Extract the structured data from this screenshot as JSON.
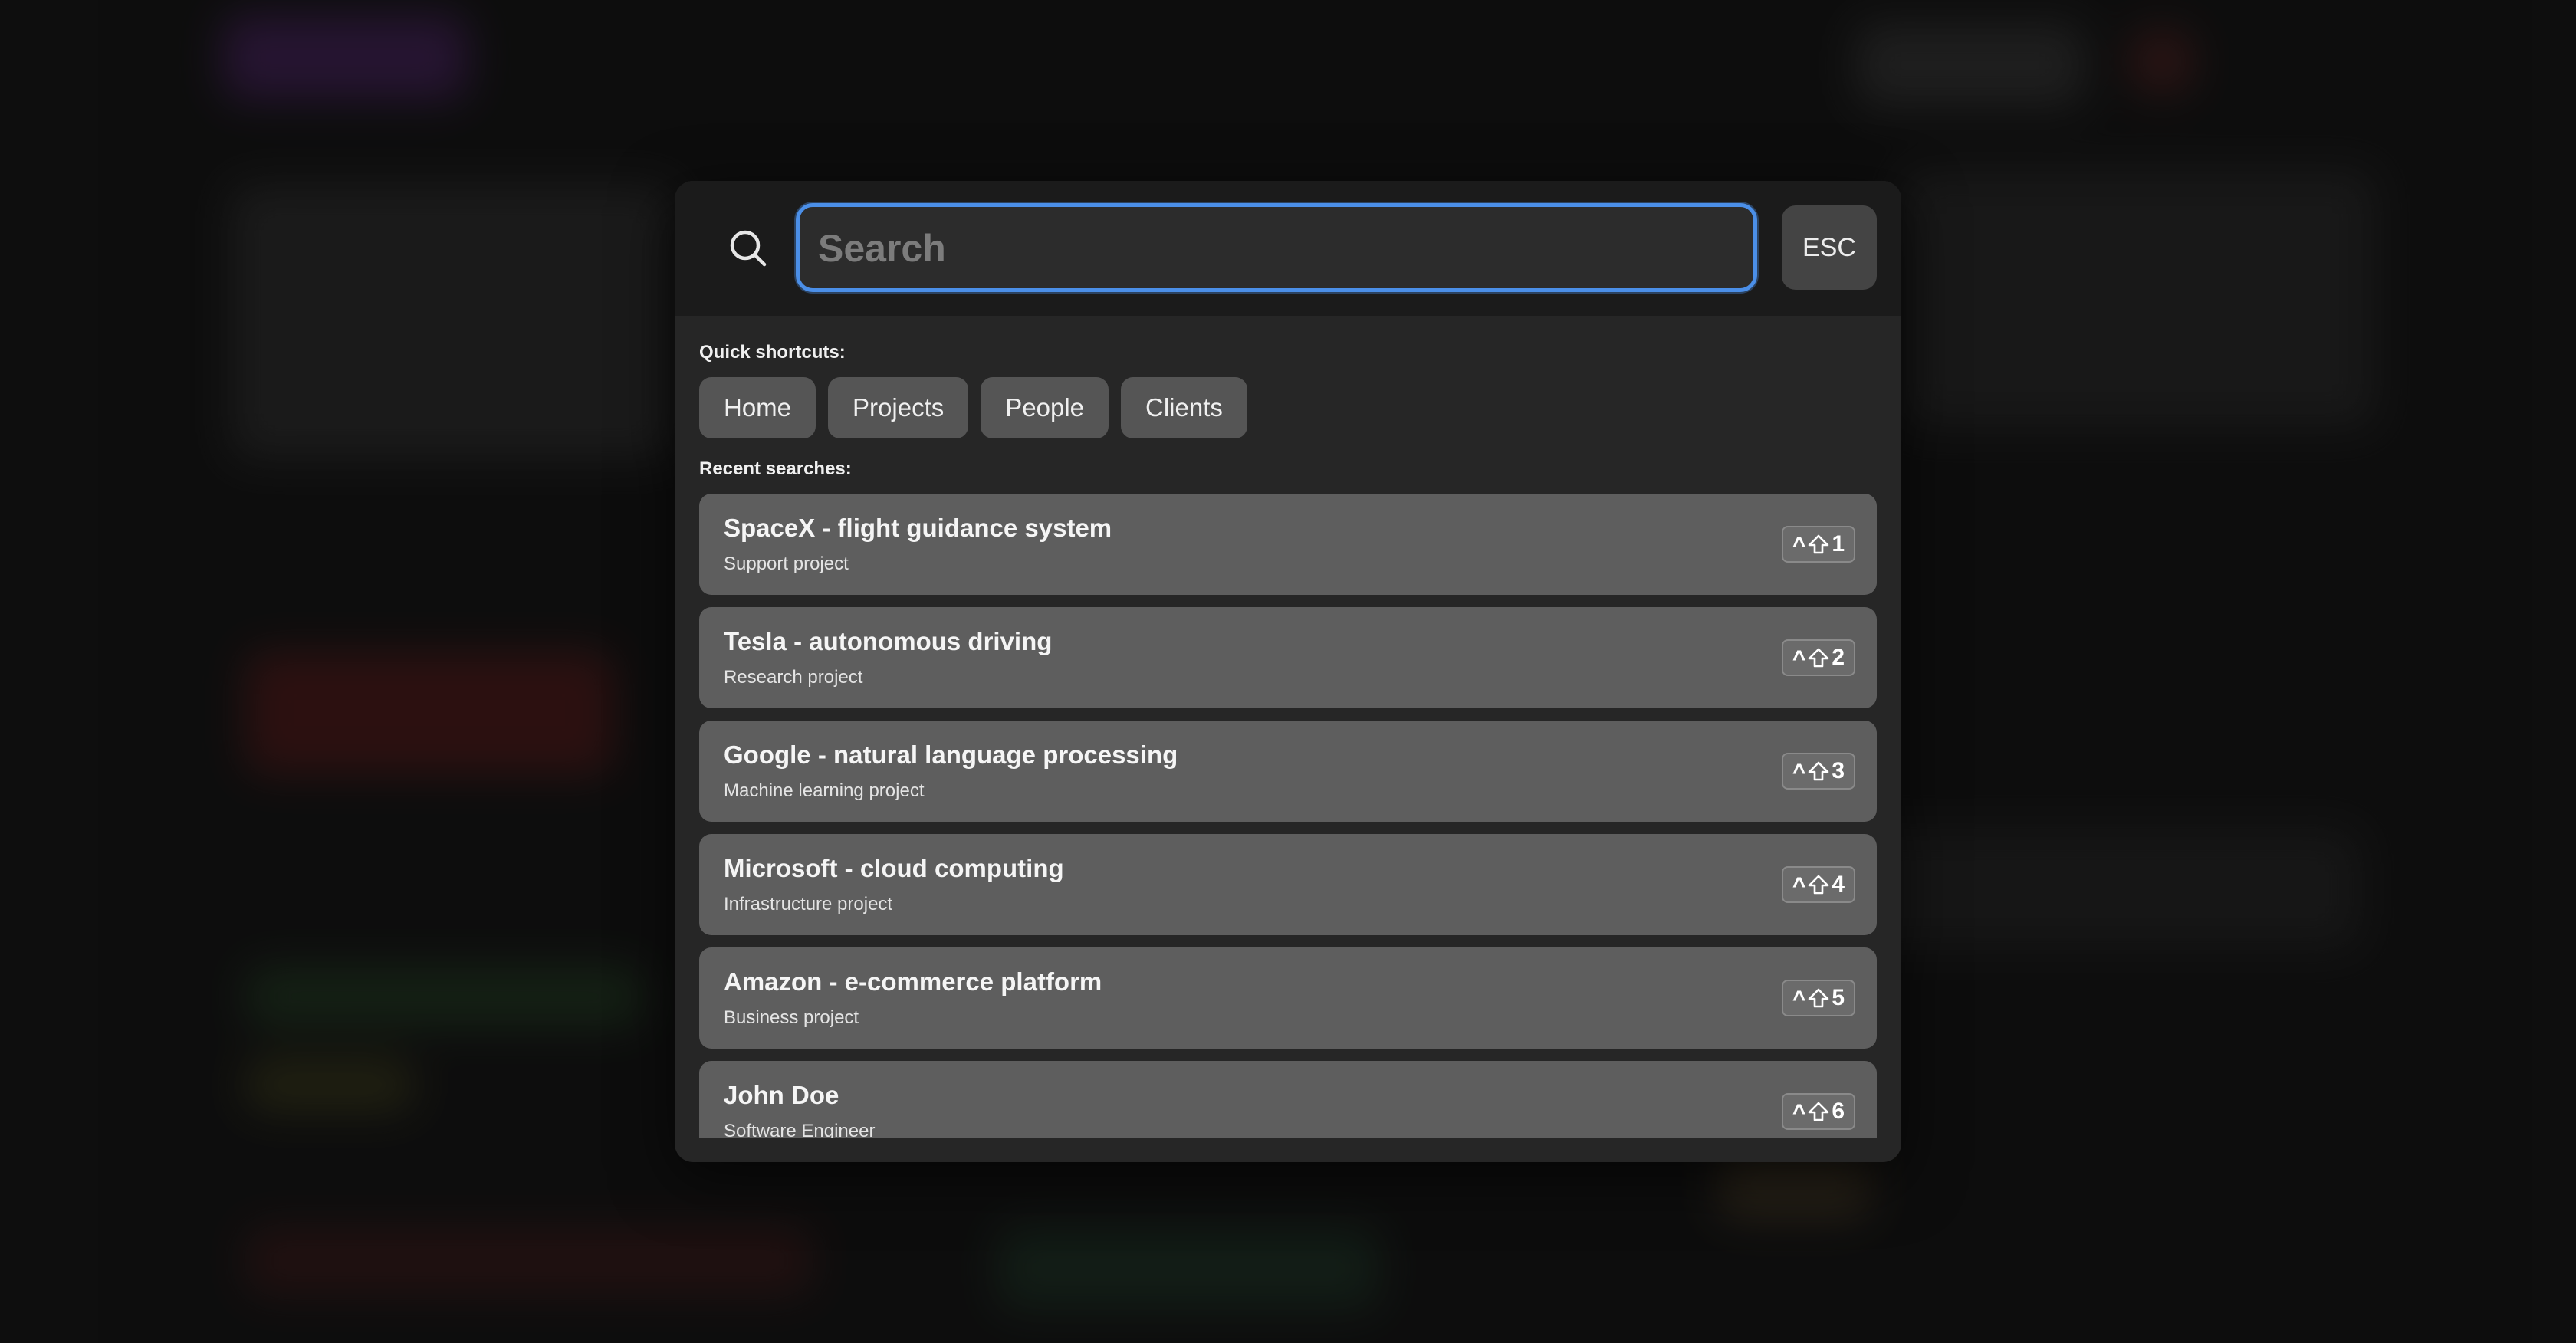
{
  "search": {
    "placeholder": "Search",
    "value": "",
    "esc_label": "ESC"
  },
  "quick_shortcuts": {
    "label": "Quick shortcuts:",
    "items": [
      "Home",
      "Projects",
      "People",
      "Clients"
    ]
  },
  "recent_searches": {
    "label": "Recent searches:",
    "items": [
      {
        "title": "SpaceX - flight guidance system",
        "subtitle": "Support project",
        "shortcut_key": "1"
      },
      {
        "title": "Tesla - autonomous driving",
        "subtitle": "Research project",
        "shortcut_key": "2"
      },
      {
        "title": "Google - natural language processing",
        "subtitle": "Machine learning project",
        "shortcut_key": "3"
      },
      {
        "title": "Microsoft - cloud computing",
        "subtitle": "Infrastructure project",
        "shortcut_key": "4"
      },
      {
        "title": "Amazon - e-commerce platform",
        "subtitle": "Business project",
        "shortcut_key": "5"
      },
      {
        "title": "John Doe",
        "subtitle": "Software Engineer",
        "shortcut_key": "6"
      }
    ],
    "shortcut_modifier_symbols": [
      "^",
      "shift-icon"
    ]
  },
  "colors": {
    "accent": "#4b8fe8",
    "modal_bg": "#262626",
    "header_bg": "#1b1b1b",
    "row_bg": "#5e5e5e",
    "chip_bg": "#555555"
  }
}
